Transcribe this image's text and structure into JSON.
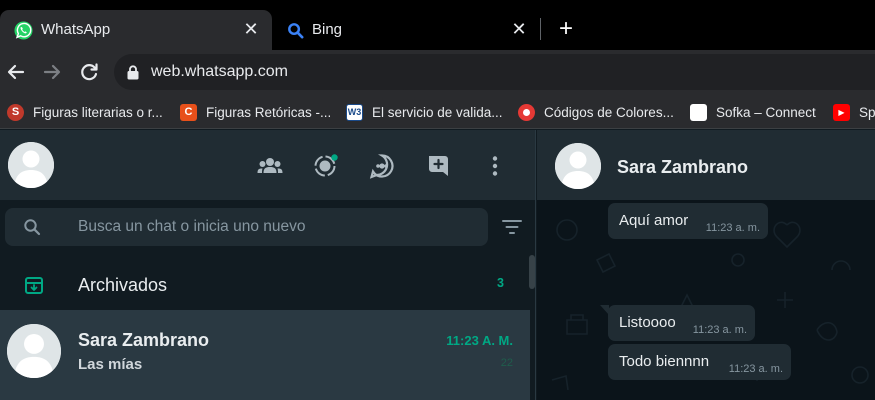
{
  "browser": {
    "tabs": [
      {
        "title": "WhatsApp",
        "icon": "whatsapp-icon",
        "active": true
      },
      {
        "title": "Bing",
        "icon": "bing-search-icon",
        "active": false
      }
    ],
    "close_glyph": "✕",
    "new_tab_glyph": "+",
    "url": "web.whatsapp.com",
    "bookmarks": [
      {
        "label": "Figuras literarias o r...",
        "icon_text": "S",
        "icon_color": "#c0392b"
      },
      {
        "label": "Figuras Retóricas -...",
        "icon_text": "C",
        "icon_color": "#e8501a"
      },
      {
        "label": "El servicio de valida...",
        "icon_text": "W3",
        "icon_color": "#ffffff"
      },
      {
        "label": "Códigos de Colores...",
        "icon_text": "",
        "icon_color": "#e53935"
      },
      {
        "label": "Sofka – Connect",
        "icon_text": "",
        "icon_color": "#ffffff"
      },
      {
        "label": "Sp",
        "icon_text": "▶",
        "icon_color": "#ff0000"
      }
    ]
  },
  "sidebar": {
    "search_placeholder": "Busca un chat o inicia uno nuevo",
    "archived": {
      "label": "Archivados",
      "count": "3"
    },
    "chats": [
      {
        "name": "Sara Zambrano",
        "last_message": "Las mías",
        "time": "11:23 A. M.",
        "badge": "22"
      }
    ]
  },
  "conversation": {
    "contact_name": "Sara Zambrano",
    "messages": [
      {
        "text": "Aquí amor",
        "time": "11:23 a. m."
      },
      {
        "text": "Listoooo",
        "time": "11:23 a. m."
      },
      {
        "text": "Todo biennnn",
        "time": "11:23 a. m."
      }
    ]
  },
  "colors": {
    "accent": "#00a884",
    "panel": "#202c33",
    "background": "#111b21",
    "chat_background": "#0b141a"
  }
}
